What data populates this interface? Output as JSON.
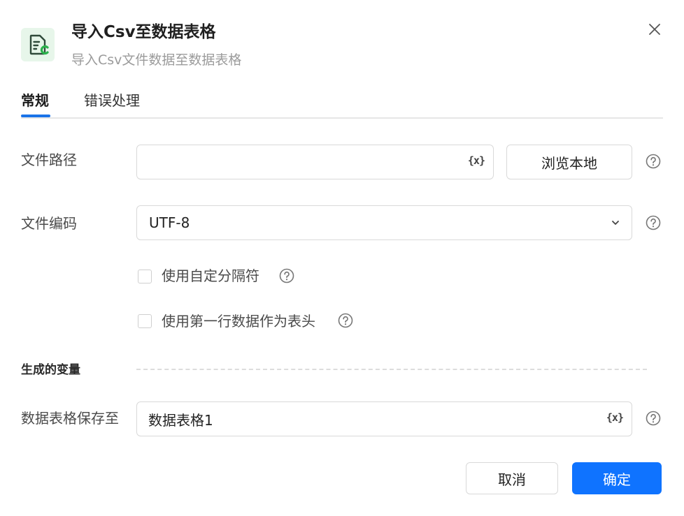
{
  "dialog": {
    "title": "导入Csv至数据表格",
    "subtitle": "导入Csv文件数据至数据表格",
    "icon": "csv-file-icon",
    "accent_color": "#0f73ff",
    "icon_color": "#2bb24c"
  },
  "tabs": [
    {
      "label": "常规",
      "active": true
    },
    {
      "label": "错误处理",
      "active": false
    }
  ],
  "form": {
    "file_path": {
      "label": "文件路径",
      "value": "",
      "placeholder": "",
      "var_icon": "{x}",
      "browse_label": "浏览本地"
    },
    "file_encoding": {
      "label": "文件编码",
      "selected": "UTF-8"
    },
    "custom_delimiter": {
      "label": "使用自定分隔符",
      "checked": false
    },
    "first_row_header": {
      "label": "使用第一行数据作为表头",
      "checked": false
    }
  },
  "output": {
    "section_title": "生成的变量",
    "save_to_label": "数据表格保存至",
    "save_to_value": "数据表格1",
    "var_icon": "{x}"
  },
  "footer": {
    "cancel_label": "取消",
    "confirm_label": "确定"
  }
}
